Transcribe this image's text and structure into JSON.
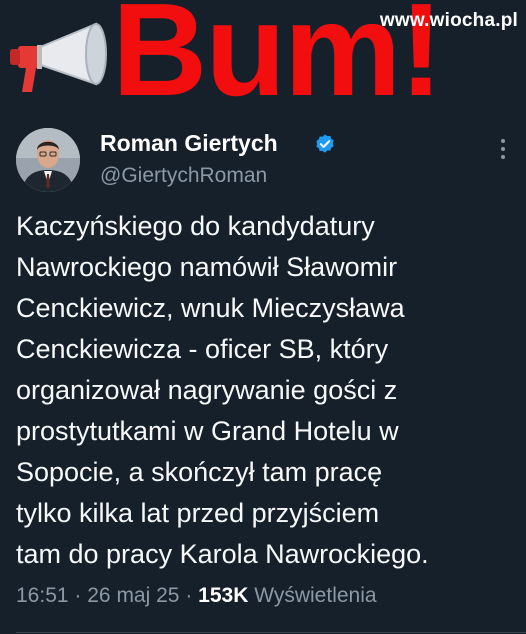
{
  "banner": {
    "title": "Bum!",
    "site": "www.wiocha.pl",
    "icon": "megaphone-icon",
    "title_color": "#f20e0e"
  },
  "tweet": {
    "author_name": "Roman Giertych",
    "author_handle": "@GiertychRoman",
    "verified": true,
    "verified_color": "#1d9bf0",
    "text_lines": [
      "Kaczyńskiego do kandydatury",
      "Nawrockiego namówił Sławomir",
      "Cenckiewicz, wnuk Mieczysława",
      "Cenckiewicza - oficer SB, który",
      "organizował nagrywanie gości z",
      "prostytutkami w Grand Hotelu w",
      "Sopocie, a skończył tam pracę",
      "tylko kilka lat przed przyjściem",
      "tam do pracy Karola Nawrockiego."
    ],
    "time": "16:51",
    "sep1": "·",
    "date": "26 maj 25",
    "sep2": "·",
    "views_count": "153K",
    "views_label": "Wyświetlenia"
  },
  "colors": {
    "background": "#15202b",
    "text": "#f7f9f9",
    "muted": "#8b98a5"
  }
}
